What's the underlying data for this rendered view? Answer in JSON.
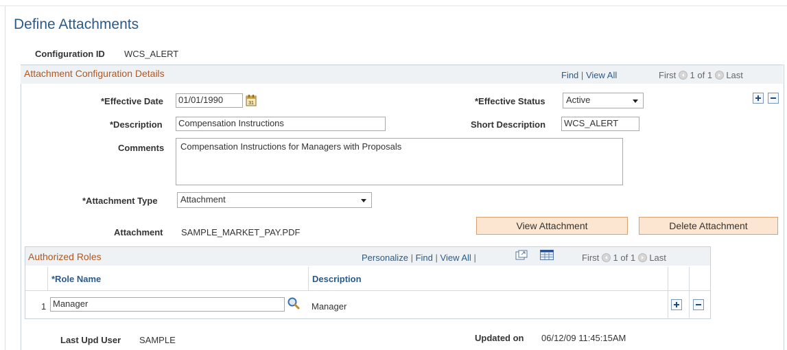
{
  "page": {
    "title": "Define Attachments",
    "config_id_label": "Configuration ID",
    "config_id_value": "WCS_ALERT"
  },
  "section": {
    "title": "Attachment Configuration Details",
    "find": "Find",
    "sep": "|",
    "view_all": "View All",
    "first": "First",
    "range": "1 of 1",
    "last": "Last"
  },
  "form": {
    "eff_date_label": "*Effective Date",
    "eff_date_value": "01/01/1990",
    "eff_status_label": "*Effective Status",
    "eff_status_value": "Active",
    "descr_label": "*Description",
    "descr_value": "Compensation Instructions",
    "short_descr_label": "Short Description",
    "short_descr_value": "WCS_ALERT",
    "comments_label": "Comments",
    "comments_value": "Compensation Instructions for Managers with Proposals",
    "attach_type_label": "*Attachment Type",
    "attach_type_value": "Attachment",
    "attachment_label": "Attachment",
    "attachment_value": "SAMPLE_MARKET_PAY.PDF",
    "view_btn": "View Attachment",
    "delete_btn": "Delete Attachment"
  },
  "roles": {
    "title": "Authorized Roles",
    "personalize": "Personalize",
    "find": "Find",
    "view_all": "View All",
    "sep": "|",
    "first": "First",
    "range": "1 of 1",
    "last": "Last",
    "col_role": "*Role Name",
    "col_desc": "Description",
    "rows": [
      {
        "num": "1",
        "role": "Manager",
        "desc": "Manager"
      }
    ]
  },
  "footer": {
    "last_upd_label": "Last Upd User",
    "last_upd_value": "SAMPLE",
    "updated_on_label": "Updated on",
    "updated_on_value": "06/12/09 11:45:15AM"
  },
  "icons": {
    "calendar": "calendar-icon",
    "add": "plus-icon",
    "remove": "minus-icon",
    "lookup": "magnifier-icon",
    "prev": "prev-arrow-icon",
    "next": "next-arrow-icon",
    "zoom": "zoom-grid-icon",
    "download": "download-grid-icon"
  },
  "colors": {
    "title_blue": "#2a5a8a",
    "section_orange": "#b3561d",
    "header_bg": "#eef2f5",
    "button_bg": "#fde6d1"
  }
}
